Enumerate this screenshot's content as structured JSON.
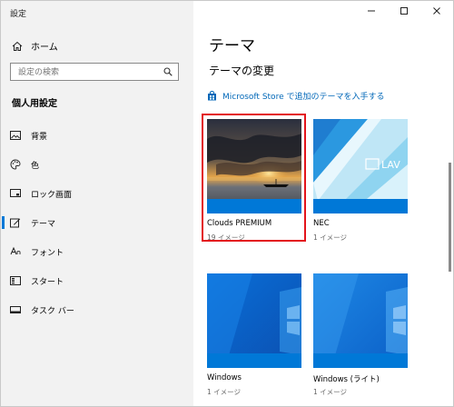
{
  "window": {
    "title": "設定"
  },
  "sidebar": {
    "home_label": "ホーム",
    "search_placeholder": "設定の検索",
    "section_title": "個人用設定",
    "items": [
      {
        "label": "背景",
        "icon": "picture-icon"
      },
      {
        "label": "色",
        "icon": "palette-icon"
      },
      {
        "label": "ロック画面",
        "icon": "lock-screen-icon"
      },
      {
        "label": "テーマ",
        "icon": "theme-brush-icon",
        "active": true
      },
      {
        "label": "フォント",
        "icon": "font-icon"
      },
      {
        "label": "スタート",
        "icon": "start-icon"
      },
      {
        "label": "タスク バー",
        "icon": "taskbar-icon"
      }
    ]
  },
  "main": {
    "title": "テーマ",
    "subtitle": "テーマの変更",
    "store_link": "Microsoft Store で追加のテーマを入手する",
    "themes": [
      {
        "name": "Clouds PREMIUM",
        "count": "19 イメージ",
        "selected": true
      },
      {
        "name": "NEC",
        "count": "1 イメージ",
        "logo_text": "LAV"
      },
      {
        "name": "Windows",
        "count": "1 イメージ"
      },
      {
        "name": "Windows (ライト)",
        "count": "1 イメージ"
      }
    ]
  },
  "colors": {
    "accent": "#0078d7",
    "highlight_border": "#e3141b",
    "sidebar_bg": "#f2f2f2"
  }
}
